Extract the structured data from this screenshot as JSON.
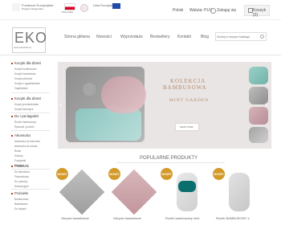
{
  "header": {
    "eu_funds_text": "Fundusze Europejskie",
    "program_text": "Program Regionalny",
    "region_text": "Pomorskie",
    "eu_text": "Unia Europejska",
    "currency_label": "Waluta: PLN",
    "language_label": "Polski",
    "login_label": "Zaloguj się",
    "cart_label": "Koszyk (0)"
  },
  "brand": {
    "logo_text": "EKO",
    "logo_url": "www.ekoidzik.eu"
  },
  "nav": {
    "items": [
      "Strona główna",
      "Nowości",
      "Wyprzedaże",
      "Bestsellery",
      "Kontakt",
      "Blog"
    ],
    "search_placeholder": "Szukaj w naszym katalogu"
  },
  "sidebar": {
    "sections": [
      {
        "title": "Kocyki dla dzieci",
        "items": [
          "Kocyki bambusowe",
          "Kocyki bawełniane",
          "Kocyki plecione",
          "Kocyki z wypełnieniem",
          "Zapiekranie"
        ]
      },
      {
        "title": "Kocyki dla dzieci",
        "items": [
          "Kocyk przedszkolaka",
          "Kocyki dziecięce"
        ]
      },
      {
        "title": "Do i pa łagodni",
        "items": [
          "Rożek bambusowy",
          "Śpiworki i pościel"
        ]
      },
      {
        "title": "Akcesoria",
        "items": [
          "Akcesoria do łóżeczka",
          "Akcesoria do wózka",
          "Rożki",
          "Kokony",
          "Pozytywki",
          "Zabawki"
        ]
      },
      {
        "title": "Poduszki",
        "items": [
          "Do karmienia",
          "Pianowkowe",
          "Do podróży",
          "Dekoracyjne"
        ]
      },
      {
        "title": "Pościele",
        "items": [
          "Bambusowe",
          "Bawełniane",
          "Do kołyski"
        ]
      }
    ]
  },
  "hero": {
    "title_line1": "KOLEKCJA",
    "title_line2": "BAMBUSOWA",
    "subtitle": "MINT GARDEN",
    "cta": "SHOP NOW",
    "colors": {
      "bg": "#e9e5e4",
      "title": "#b38b6d"
    }
  },
  "products": {
    "heading": "POPULARNE PRODUKTY",
    "badge_label": "NOWY",
    "items": [
      {
        "name": "Okrycie bawełniane"
      },
      {
        "name": "Okrycie bawełniane"
      },
      {
        "name": "Rożek bambusowy mint"
      },
      {
        "name": "Rożek BAMBUSOWY z"
      }
    ]
  },
  "colors": {
    "accent": "#d39a2a",
    "nav_text": "#666666",
    "sidebar_title": "#333333"
  }
}
